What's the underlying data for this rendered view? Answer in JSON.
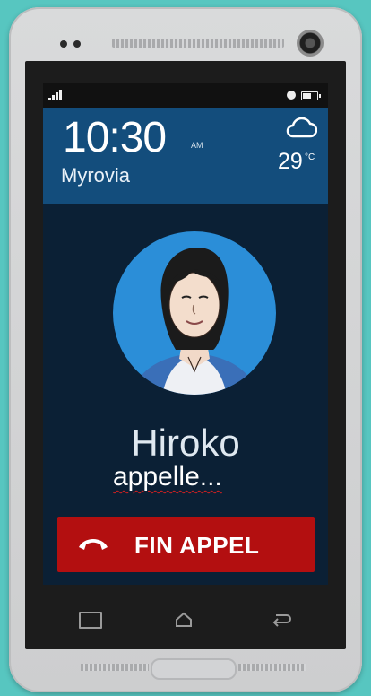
{
  "clock": {
    "time": "10:30",
    "ampm": "AM",
    "city": "Myrovia"
  },
  "weather": {
    "icon": "cloud-icon",
    "temperature": "29",
    "unit": "°C"
  },
  "call": {
    "caller_name": "Hiroko",
    "status": "appelle...",
    "end_button_label": "FIN APPEL",
    "end_button_icon": "phone-hangup-icon"
  },
  "colors": {
    "background": "#57c6c0",
    "screen": "#0b2035",
    "info_card": "#134d7c",
    "avatar_bg": "#2b8ed8",
    "end_call": "#b30f10"
  },
  "navigation": {
    "recent_icon": "recent-apps-icon",
    "home_icon": "home-icon",
    "back_icon": "back-icon"
  }
}
